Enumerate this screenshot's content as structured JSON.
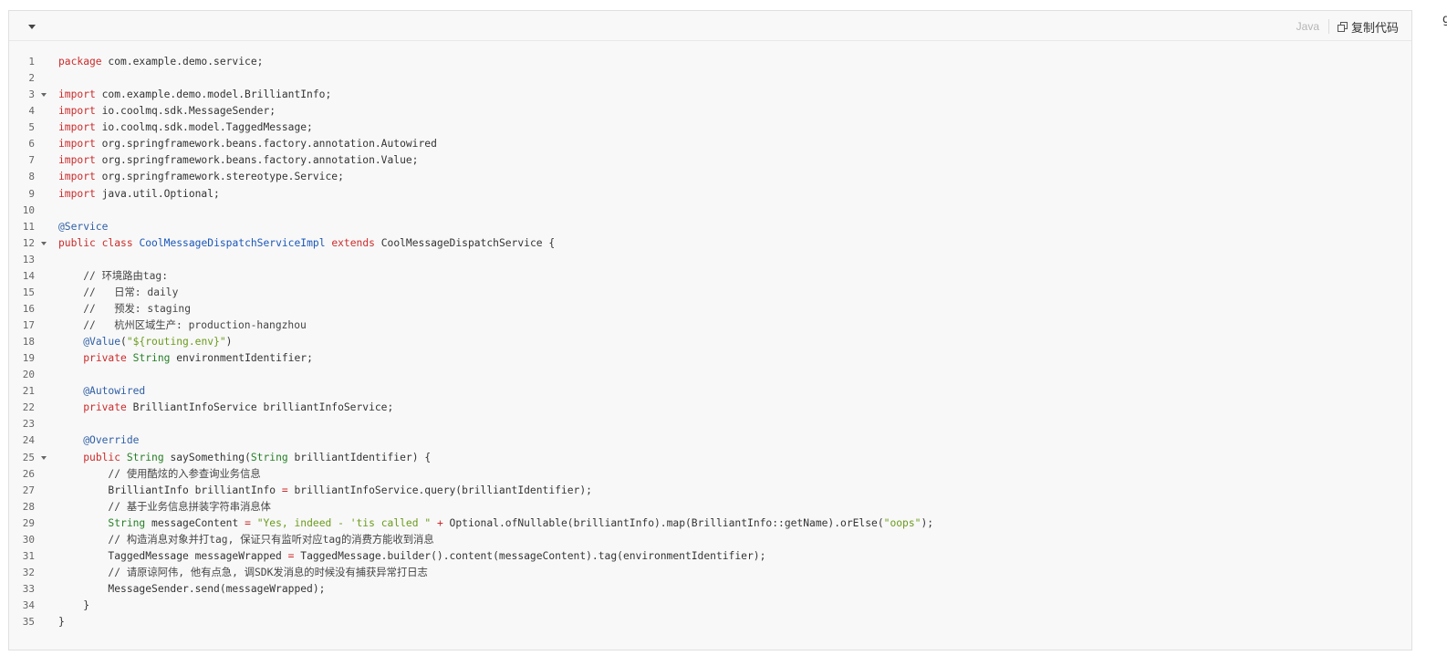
{
  "toolbar": {
    "language": "Java",
    "copy_label": "复制代码"
  },
  "edge_glyph": "g",
  "code_lines": [
    {
      "n": "1",
      "fold": false,
      "tokens": [
        {
          "t": "package",
          "c": "kw"
        },
        {
          "t": " com.example.demo.service;"
        }
      ]
    },
    {
      "n": "2",
      "fold": false,
      "tokens": []
    },
    {
      "n": "3",
      "fold": true,
      "tokens": [
        {
          "t": "import",
          "c": "kw"
        },
        {
          "t": " com.example.demo.model.BrilliantInfo;"
        }
      ]
    },
    {
      "n": "4",
      "fold": false,
      "tokens": [
        {
          "t": "import",
          "c": "kw"
        },
        {
          "t": " io.coolmq.sdk.MessageSender;"
        }
      ]
    },
    {
      "n": "5",
      "fold": false,
      "tokens": [
        {
          "t": "import",
          "c": "kw"
        },
        {
          "t": " io.coolmq.sdk.model.TaggedMessage;"
        }
      ]
    },
    {
      "n": "6",
      "fold": false,
      "tokens": [
        {
          "t": "import",
          "c": "kw"
        },
        {
          "t": " org.springframework.beans.factory.annotation.Autowired"
        }
      ]
    },
    {
      "n": "7",
      "fold": false,
      "tokens": [
        {
          "t": "import",
          "c": "kw"
        },
        {
          "t": " org.springframework.beans.factory.annotation.Value;"
        }
      ]
    },
    {
      "n": "8",
      "fold": false,
      "tokens": [
        {
          "t": "import",
          "c": "kw"
        },
        {
          "t": " org.springframework.stereotype.Service;"
        }
      ]
    },
    {
      "n": "9",
      "fold": false,
      "tokens": [
        {
          "t": "import",
          "c": "kw"
        },
        {
          "t": " java.util.Optional;"
        }
      ]
    },
    {
      "n": "10",
      "fold": false,
      "tokens": []
    },
    {
      "n": "11",
      "fold": false,
      "tokens": [
        {
          "t": "@Service",
          "c": "ann"
        }
      ]
    },
    {
      "n": "12",
      "fold": true,
      "tokens": [
        {
          "t": "public",
          "c": "kw"
        },
        {
          "t": " "
        },
        {
          "t": "class",
          "c": "kw"
        },
        {
          "t": " "
        },
        {
          "t": "CoolMessageDispatchServiceImpl",
          "c": "cls"
        },
        {
          "t": " "
        },
        {
          "t": "extends",
          "c": "kw"
        },
        {
          "t": " CoolMessageDispatchService {"
        }
      ]
    },
    {
      "n": "13",
      "fold": false,
      "tokens": []
    },
    {
      "n": "14",
      "fold": false,
      "tokens": [
        {
          "t": "    // 环境路由tag:",
          "c": "cm"
        }
      ]
    },
    {
      "n": "15",
      "fold": false,
      "tokens": [
        {
          "t": "    //   日常: daily",
          "c": "cm"
        }
      ]
    },
    {
      "n": "16",
      "fold": false,
      "tokens": [
        {
          "t": "    //   预发: staging",
          "c": "cm"
        }
      ]
    },
    {
      "n": "17",
      "fold": false,
      "tokens": [
        {
          "t": "    //   杭州区域生产: production-hangzhou",
          "c": "cm"
        }
      ]
    },
    {
      "n": "18",
      "fold": false,
      "tokens": [
        {
          "t": "    "
        },
        {
          "t": "@Value",
          "c": "ann"
        },
        {
          "t": "("
        },
        {
          "t": "\"${routing.env}\"",
          "c": "str"
        },
        {
          "t": ")"
        }
      ]
    },
    {
      "n": "19",
      "fold": false,
      "tokens": [
        {
          "t": "    "
        },
        {
          "t": "private",
          "c": "kw"
        },
        {
          "t": " "
        },
        {
          "t": "String",
          "c": "ty"
        },
        {
          "t": " environmentIdentifier;"
        }
      ]
    },
    {
      "n": "20",
      "fold": false,
      "tokens": []
    },
    {
      "n": "21",
      "fold": false,
      "tokens": [
        {
          "t": "    "
        },
        {
          "t": "@Autowired",
          "c": "ann"
        }
      ]
    },
    {
      "n": "22",
      "fold": false,
      "tokens": [
        {
          "t": "    "
        },
        {
          "t": "private",
          "c": "kw"
        },
        {
          "t": " BrilliantInfoService brilliantInfoService;"
        }
      ]
    },
    {
      "n": "23",
      "fold": false,
      "tokens": []
    },
    {
      "n": "24",
      "fold": false,
      "tokens": [
        {
          "t": "    "
        },
        {
          "t": "@Override",
          "c": "ann"
        }
      ]
    },
    {
      "n": "25",
      "fold": true,
      "tokens": [
        {
          "t": "    "
        },
        {
          "t": "public",
          "c": "kw"
        },
        {
          "t": " "
        },
        {
          "t": "String",
          "c": "ty"
        },
        {
          "t": " saySomething("
        },
        {
          "t": "String",
          "c": "ty"
        },
        {
          "t": " brilliantIdentifier) {"
        }
      ]
    },
    {
      "n": "26",
      "fold": false,
      "tokens": [
        {
          "t": "        // 使用酷炫的入参查询业务信息",
          "c": "cm"
        }
      ]
    },
    {
      "n": "27",
      "fold": false,
      "tokens": [
        {
          "t": "        BrilliantInfo brilliantInfo "
        },
        {
          "t": "=",
          "c": "op"
        },
        {
          "t": " brilliantInfoService.query(brilliantIdentifier);"
        }
      ]
    },
    {
      "n": "28",
      "fold": false,
      "tokens": [
        {
          "t": "        // 基于业务信息拼装字符串消息体",
          "c": "cm"
        }
      ]
    },
    {
      "n": "29",
      "fold": false,
      "tokens": [
        {
          "t": "        "
        },
        {
          "t": "String",
          "c": "ty"
        },
        {
          "t": " messageContent "
        },
        {
          "t": "=",
          "c": "op"
        },
        {
          "t": " "
        },
        {
          "t": "\"Yes, indeed - 'tis called \"",
          "c": "str"
        },
        {
          "t": " "
        },
        {
          "t": "+",
          "c": "op"
        },
        {
          "t": " Optional.ofNullable(brilliantInfo).map(BrilliantInfo::getName).orElse("
        },
        {
          "t": "\"oops\"",
          "c": "str"
        },
        {
          "t": ");"
        }
      ]
    },
    {
      "n": "30",
      "fold": false,
      "tokens": [
        {
          "t": "        // 构造消息对象并打tag, 保证只有监听对应tag的消费方能收到消息",
          "c": "cm"
        }
      ]
    },
    {
      "n": "31",
      "fold": false,
      "tokens": [
        {
          "t": "        TaggedMessage messageWrapped "
        },
        {
          "t": "=",
          "c": "op"
        },
        {
          "t": " TaggedMessage.builder().content(messageContent).tag(environmentIdentifier);"
        }
      ]
    },
    {
      "n": "32",
      "fold": false,
      "tokens": [
        {
          "t": "        // 请原谅阿伟, 他有点急, 调SDK发消息的时候没有捕获异常打日志",
          "c": "cm"
        }
      ]
    },
    {
      "n": "33",
      "fold": false,
      "tokens": [
        {
          "t": "        MessageSender.send(messageWrapped);"
        }
      ]
    },
    {
      "n": "34",
      "fold": false,
      "tokens": [
        {
          "t": "    }"
        }
      ]
    },
    {
      "n": "35",
      "fold": false,
      "tokens": [
        {
          "t": "}"
        }
      ]
    }
  ]
}
